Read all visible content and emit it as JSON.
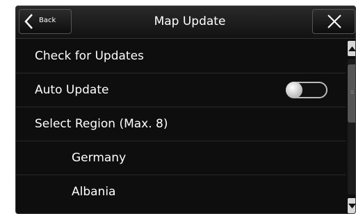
{
  "header": {
    "back_label": "Back",
    "title": "Map Update",
    "close_icon": "close-icon",
    "back_icon": "chevron-left-icon"
  },
  "menu": {
    "check_updates": "Check for Updates",
    "auto_update": "Auto Update",
    "auto_update_on": false,
    "select_region": "Select Region (Max. 8)",
    "regions": [
      "Germany",
      "Albania"
    ]
  },
  "colors": {
    "background": "#0e0e0e",
    "text": "#ffffff"
  }
}
